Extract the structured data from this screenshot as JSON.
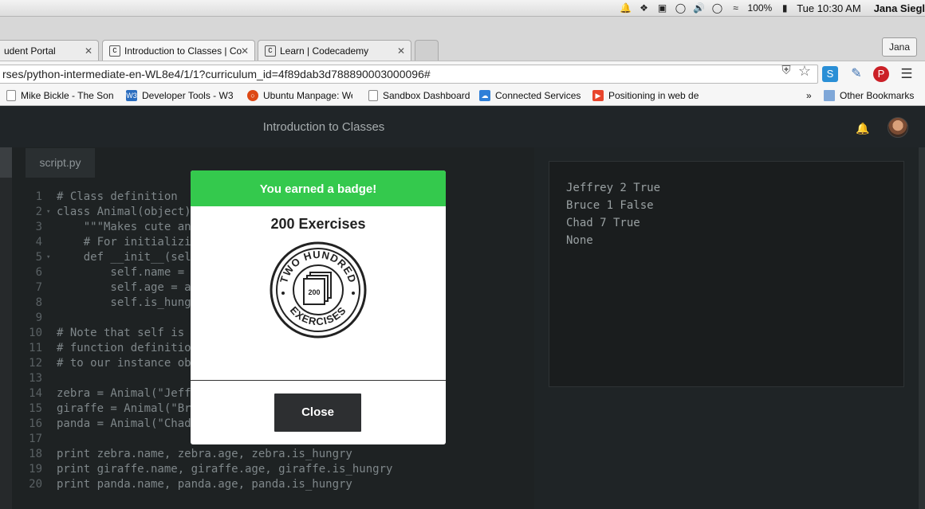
{
  "menubar": {
    "battery": "100%",
    "time": "Tue 10:30 AM",
    "user": "Jana Siegl"
  },
  "tabs": [
    {
      "label": "udent Portal",
      "favicon": ""
    },
    {
      "label": "Introduction to Classes | Co",
      "favicon": "C",
      "active": true
    },
    {
      "label": "Learn | Codecademy",
      "favicon": "C"
    }
  ],
  "profile": {
    "name": "Jana"
  },
  "address": {
    "url": "rses/python-intermediate-en-WL8e4/1/1?curriculum_id=4f89dab3d788890003000096#"
  },
  "bookmarks": {
    "items": [
      {
        "label": "Mike Bickle - The Son",
        "icon": "page-icon",
        "color": "#ffffff"
      },
      {
        "label": "Developer Tools - W3",
        "icon": "w3-icon",
        "color": "#2a6dbf"
      },
      {
        "label": "Ubuntu Manpage: Wel",
        "icon": "ubuntu-icon",
        "color": "#dd4814"
      },
      {
        "label": "Sandbox Dashboard",
        "icon": "page-icon",
        "color": "#ffffff"
      },
      {
        "label": "Connected Services",
        "icon": "cloud-icon",
        "color": "#2f7fd8"
      },
      {
        "label": "Positioning in web de",
        "icon": "video-icon",
        "color": "#e8452c"
      }
    ],
    "overflow": "»",
    "other": "Other Bookmarks"
  },
  "app": {
    "title": "Introduction to Classes"
  },
  "editor": {
    "file_tab": "script.py",
    "lines": [
      {
        "n": "1",
        "t": "# Class definition",
        "k": "com"
      },
      {
        "n": "2",
        "t": "class Animal(object)",
        "k": "kw",
        "fold": true
      },
      {
        "n": "3",
        "t": "    \"\"\"Makes cute an",
        "k": "str"
      },
      {
        "n": "4",
        "t": "    # For initializi",
        "k": "com"
      },
      {
        "n": "5",
        "t": "    def __init__(sel",
        "k": "kw",
        "fold": true
      },
      {
        "n": "6",
        "t": "        self.name = ",
        "k": ""
      },
      {
        "n": "7",
        "t": "        self.age = a",
        "k": ""
      },
      {
        "n": "8",
        "t": "        self.is_hung",
        "k": ""
      },
      {
        "n": "9",
        "t": "",
        "k": ""
      },
      {
        "n": "10",
        "t": "# Note that self is",
        "k": "com"
      },
      {
        "n": "11",
        "t": "# function definitio",
        "k": "com"
      },
      {
        "n": "12",
        "t": "# to our instance ob",
        "k": "com"
      },
      {
        "n": "13",
        "t": "",
        "k": ""
      },
      {
        "n": "14",
        "t": "zebra = Animal(\"Jeff",
        "k": ""
      },
      {
        "n": "15",
        "t": "giraffe = Animal(\"Br",
        "k": ""
      },
      {
        "n": "16",
        "t": "panda = Animal(\"Chad",
        "k": ""
      },
      {
        "n": "17",
        "t": "",
        "k": ""
      },
      {
        "n": "18",
        "t": "print zebra.name, zebra.age, zebra.is_hungry",
        "k": ""
      },
      {
        "n": "19",
        "t": "print giraffe.name, giraffe.age, giraffe.is_hungry",
        "k": ""
      },
      {
        "n": "20",
        "t": "print panda.name, panda.age, panda.is_hungry",
        "k": ""
      }
    ]
  },
  "console": {
    "lines": [
      "Jeffrey 2 True",
      "Bruce 1 False",
      "Chad 7 True",
      "None"
    ]
  },
  "modal": {
    "header": "You earned a badge!",
    "title": "200 Exercises",
    "badge_top": "TWO HUNDRED",
    "badge_bottom": "EXERCISES",
    "badge_number": "200",
    "close": "Close",
    "accent": "#34c94d"
  }
}
